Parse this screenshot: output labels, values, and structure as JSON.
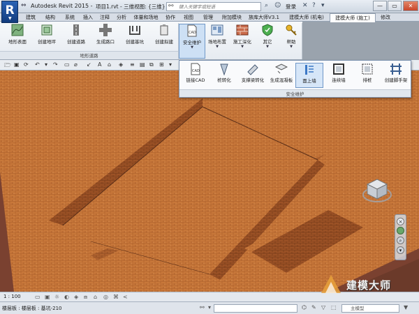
{
  "titlebar": {
    "app_title": "Autodesk Revit 2015 -",
    "doc_title": "项目1.rvt - 三维视图: {三维}",
    "search_placeholder": "键入关键字或短语",
    "login": "登录"
  },
  "tabs": [
    {
      "label": "建筑"
    },
    {
      "label": "结构"
    },
    {
      "label": "系统"
    },
    {
      "label": "插入"
    },
    {
      "label": "注释"
    },
    {
      "label": "分析"
    },
    {
      "label": "体量和场地"
    },
    {
      "label": "协作"
    },
    {
      "label": "视图"
    },
    {
      "label": "管理"
    },
    {
      "label": "附加模块"
    },
    {
      "label": "族库大师V3.1"
    },
    {
      "label": "建模大师 (机电)"
    },
    {
      "label": "建模大师 (施工)"
    },
    {
      "label": "修改"
    }
  ],
  "ribbon": {
    "buttons": [
      {
        "label": "地形表面"
      },
      {
        "label": "创建地坪"
      },
      {
        "label": "创建道路"
      },
      {
        "label": "生成路口"
      },
      {
        "label": "创建基坑"
      },
      {
        "label": "创建拟建"
      },
      {
        "label": "安全维护"
      },
      {
        "label": "场地布置"
      },
      {
        "label": "施工深化"
      },
      {
        "label": "其它"
      },
      {
        "label": "帮助"
      }
    ],
    "group_label": "地形道路",
    "cad_badge": "CAD"
  },
  "flyout": {
    "buttons": [
      {
        "label": "链接CAD"
      },
      {
        "label": "桩转化"
      },
      {
        "label": "支撑梁转化"
      },
      {
        "label": "生成混凝板"
      },
      {
        "label": "面上墙"
      },
      {
        "label": "连续墙"
      },
      {
        "label": "排桩"
      },
      {
        "label": "创建脚手架"
      }
    ],
    "group_label": "安全维护",
    "cad_badge": "CAD"
  },
  "viewport": {
    "brand": "建模大师"
  },
  "viewctrl": {
    "scale": "1 : 100"
  },
  "statusbar": {
    "text": "楼层板 : 楼层板 : 基坑-210",
    "model": "主模型"
  },
  "colors": {
    "terrain": "#c87a3a",
    "terrain_dark": "#8a4a22",
    "background_floor": "#6b3a2a",
    "ribbon_pressed": "#cde0f5",
    "accent_blue": "#2a63b5"
  }
}
